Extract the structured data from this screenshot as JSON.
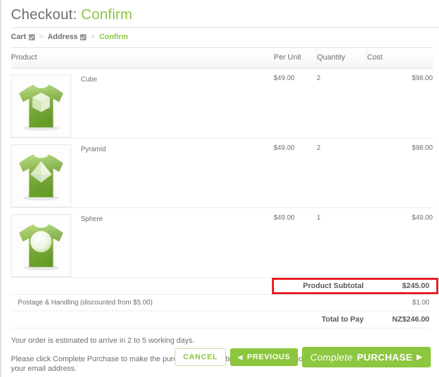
{
  "header": {
    "title_prefix": "Checkout:",
    "title_accent": "Confirm",
    "accent_color": "#8dc63f"
  },
  "breadcrumb": {
    "items": [
      {
        "label": "Cart",
        "completed": true
      },
      {
        "label": "Address",
        "completed": true
      },
      {
        "label": "Confirm",
        "completed": false
      }
    ],
    "separator": ">"
  },
  "table": {
    "headers": {
      "product": "Product",
      "per_unit": "Per Unit",
      "quantity": "Quantity",
      "cost": "Cost"
    },
    "rows": [
      {
        "name": "Cube",
        "per_unit": "$49.00",
        "quantity": "2",
        "cost": "$98.00",
        "thumb": "tshirt-cube-icon"
      },
      {
        "name": "Pyramid",
        "per_unit": "$49.00",
        "quantity": "2",
        "cost": "$98.00",
        "thumb": "tshirt-pyramid-icon"
      },
      {
        "name": "Sphere",
        "per_unit": "$49.00",
        "quantity": "1",
        "cost": "$49.00",
        "thumb": "tshirt-sphere-icon"
      }
    ]
  },
  "totals": {
    "subtotal_label": "Product Subtotal",
    "subtotal_value": "$245.00",
    "postage_label": "Postage & Handling (discounted from $5.00)",
    "postage_value": "$1.00",
    "total_label": "Total to Pay",
    "total_value": "NZ$246.00",
    "highlight_color": "#ec1c24"
  },
  "notes": {
    "delivery": "Your order is estimated to arrive in 2 to 5 working days.",
    "instructions": "Please click Complete Purchase to make the purchase at which time payment instructions will be both displayed and sent to your email address."
  },
  "actions": {
    "cancel_label": "CANCEL",
    "previous_label": "PREVIOUS",
    "previous_arrow": "◀",
    "complete_lead": "Complete",
    "complete_strong": "PURCHASE",
    "complete_arrow": "▶"
  }
}
